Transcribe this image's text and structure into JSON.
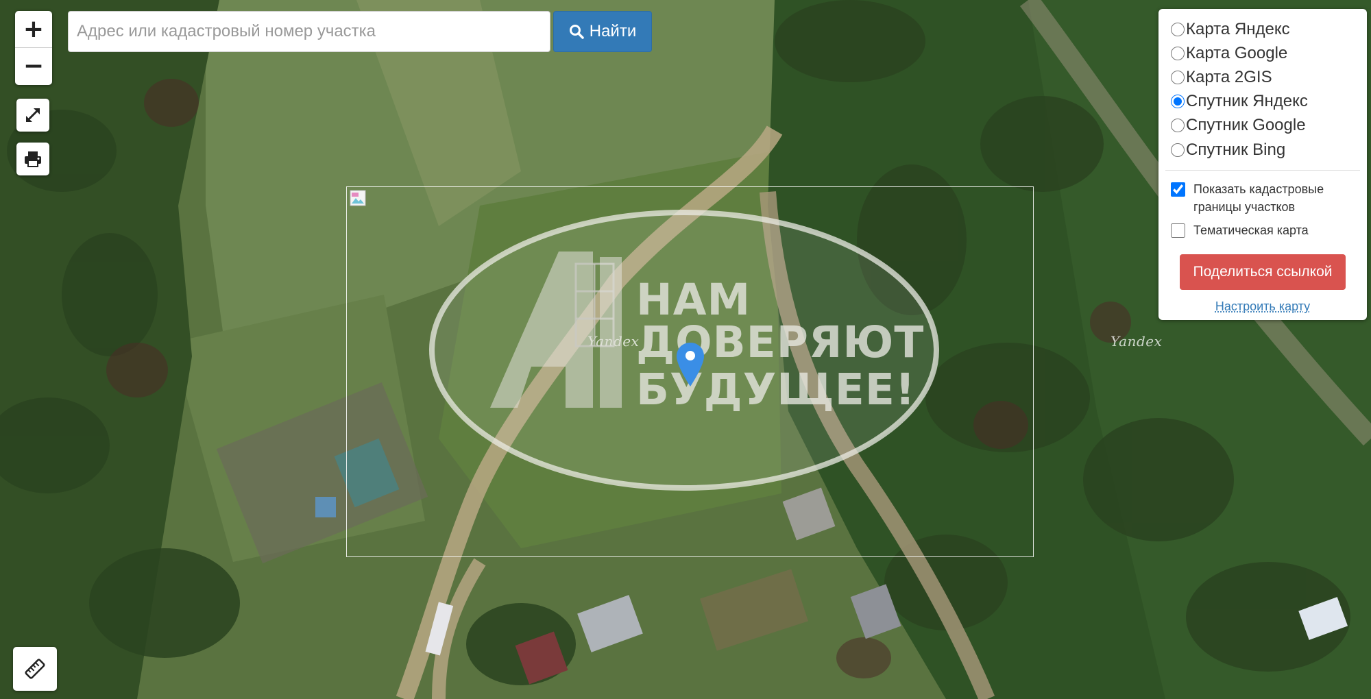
{
  "map": {
    "watermarks": [
      "Yandex",
      "Yandex"
    ],
    "marker_icon": "map-pin-icon"
  },
  "promo": {
    "slogan_lines": [
      "НАМ",
      "ДОВЕРЯЮТ",
      "БУДУЩЕЕ!"
    ],
    "logo_letters": "АН"
  },
  "controls": {
    "zoom_in_label": "+",
    "zoom_out_label": "−",
    "fullscreen_icon": "expand-icon",
    "print_icon": "printer-icon",
    "ruler_icon": "ruler-icon"
  },
  "search": {
    "placeholder": "Адрес или кадастровый номер участка",
    "button_label": "Найти",
    "button_icon": "search-icon"
  },
  "layers": {
    "base_maps": [
      {
        "label": "Карта Яндекс",
        "selected": false
      },
      {
        "label": "Карта Google",
        "selected": false
      },
      {
        "label": "Карта 2GIS",
        "selected": false
      },
      {
        "label": "Спутник Яндекс",
        "selected": true
      },
      {
        "label": "Спутник Google",
        "selected": false
      },
      {
        "label": "Спутник Bing",
        "selected": false
      }
    ],
    "show_cadastral_label": "Показать кадастровые границы участков",
    "show_cadastral_checked": true,
    "thematic_label": "Тематическая карта",
    "thematic_checked": false,
    "share_button_label": "Поделиться ссылкой",
    "configure_link_label": "Настроить карту"
  },
  "colors": {
    "primary": "#337ab7",
    "danger": "#d9534f",
    "marker": "#3a8ee6"
  }
}
